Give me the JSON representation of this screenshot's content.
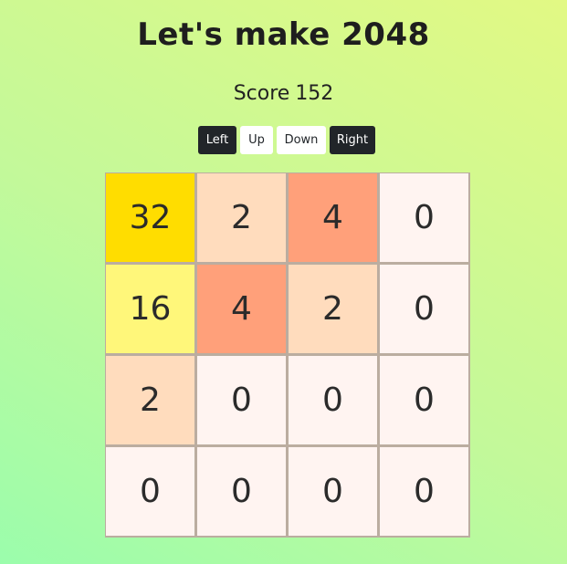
{
  "title": "Let's make 2048",
  "score": {
    "label": "Score",
    "value": "152"
  },
  "controls": [
    {
      "label": "Left",
      "style": "dark"
    },
    {
      "label": "Up",
      "style": "light"
    },
    {
      "label": "Down",
      "style": "light"
    },
    {
      "label": "Right",
      "style": "dark"
    }
  ],
  "board": [
    [
      "32",
      "2",
      "4",
      "0"
    ],
    [
      "16",
      "4",
      "2",
      "0"
    ],
    [
      "2",
      "0",
      "0",
      "0"
    ],
    [
      "0",
      "0",
      "0",
      "0"
    ]
  ],
  "tile_colors": {
    "0": "#fff4f1",
    "2": "#ffdcbd",
    "4": "#ffa07a",
    "16": "#fff77a",
    "32": "#ffdd00"
  }
}
